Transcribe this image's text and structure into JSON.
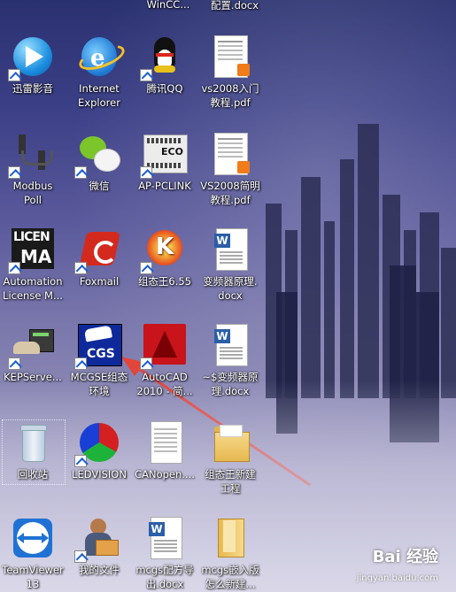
{
  "top_labels": [
    "WinCC...",
    "配置.docx"
  ],
  "icons": {
    "xunlei": "迅雷影音",
    "ie": "Internet\nExplorer",
    "qq": "腾讯QQ",
    "vs_intro": "vs2008入门\n教程.pdf",
    "modbus": "Modbus\nPoll",
    "wechat": "微信",
    "appclink": "AP-PCLINK",
    "vs_brief": "VS2008简明\n教程.pdf",
    "license": "Automation\nLicense M...",
    "foxmail": "Foxmail",
    "kingview": "组态王6.55",
    "inverter": "变频器原理.\ndocx",
    "kepserver": "KEPServe...",
    "mcgse": "MCGSE组态\n环境",
    "autocad": "AutoCAD\n2010 - 简...",
    "inverter_tmp": "~$变频器原\n理.docx",
    "recycle": "回收站",
    "ledvision": "LEDVISION",
    "canopen": "CANopen....",
    "kingview_new": "组态王新建\n工程",
    "teamviewer": "TeamViewer\n13",
    "mydocs": "我的文件",
    "mcgs_export": "mcgs配方导\n出.docx",
    "mcgs_embed": "mcgs嵌入版\n怎么新建..."
  },
  "icon_text": {
    "licen": "LICEN",
    "ma": "MA",
    "cgs": "CGS",
    "eco": "ECO",
    "k": "K"
  },
  "watermark": {
    "brand": "Bai 经验",
    "url": "jingyan.baidu.com"
  },
  "colors": {
    "annotation_arrow": "#e2453a",
    "sky_top": "#2a3170",
    "sky_bottom": "#bab7cf"
  }
}
